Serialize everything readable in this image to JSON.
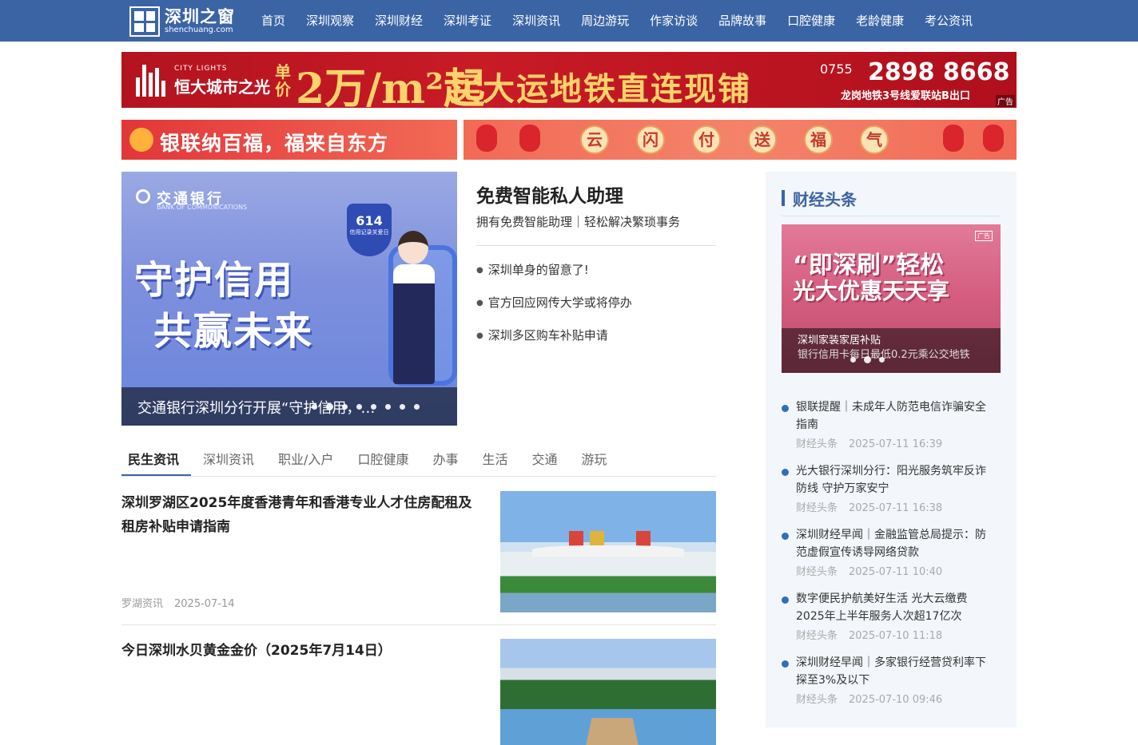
{
  "site": {
    "logo_cn": "深圳之窗",
    "logo_en": "shenchuang.com"
  },
  "nav": {
    "items": [
      "首页",
      "深圳观察",
      "深圳财经",
      "深圳考证",
      "深圳资讯",
      "周边游玩",
      "作家访谈",
      "品牌故事",
      "口腔健康",
      "老龄健康",
      "考公资讯"
    ]
  },
  "ads": {
    "top": {
      "brand_en": "CITY LIGHTS",
      "brand_cn": "恒大城市之光",
      "price_prefix": "单价",
      "price": "2万/m²起",
      "slogan": "买大运地铁直连现铺",
      "tel_area": "0755",
      "tel": "2898 8668",
      "address": "龙岗地铁3号线爱联站B出口",
      "tag": "广告"
    },
    "banner_left": "银联纳百福，福来自东方",
    "banner_right_chars": [
      "云",
      "闪",
      "付",
      "送",
      "福",
      "气"
    ]
  },
  "slider": {
    "bank": "交通银行",
    "bank_sub": "BANK OF COMMUNICATIONS",
    "badge_num": "614",
    "badge_text": "信用记录关爱日",
    "headline1": "守护信用",
    "headline2": "共赢未来",
    "caption": "交通银行深圳分行开展“守护信用，共赢未来”",
    "dot_count": 8,
    "active_dot": 1
  },
  "assistant": {
    "title": "免费智能私人助理",
    "desc": "拥有免费智能助理｜轻松解决繁琐事务",
    "links": [
      "深圳单身的留意了!",
      "官方回应网传大学或将停办",
      "深圳多区购车补贴申请"
    ]
  },
  "tabs": [
    "民生资讯",
    "深圳资讯",
    "职业/入户",
    "口腔健康",
    "办事",
    "生活",
    "交通",
    "游玩"
  ],
  "news": [
    {
      "title": "深圳罗湖区2025年度香港青年和香港专业人才住房配租及租房补贴申请指南",
      "source": "罗湖资讯",
      "date": "2025-07-14"
    },
    {
      "title": "今日深圳水贝黄金金价（2025年7月14日）"
    }
  ],
  "sidebar": {
    "heading": "财经头条",
    "slide": {
      "headline1": "“即深刷”轻松",
      "headline2": "光大优惠天天享",
      "caption": "深圳家装家居补贴",
      "caption2": "银行信用卡每日最低0.2元乘公交地铁",
      "tag": "广告"
    },
    "items": [
      {
        "title": "银联提醒｜未成年人防范电信诈骗安全指南",
        "source": "财经头条",
        "time": "2025-07-11 16:39"
      },
      {
        "title": "光大银行深圳分行：阳光服务筑牢反诈防线 守护万家安宁",
        "source": "财经头条",
        "time": "2025-07-11 16:38"
      },
      {
        "title": "深圳财经早闻｜金融监管总局提示：防范虚假宣传诱导网络贷款",
        "source": "财经头条",
        "time": "2025-07-11 10:40"
      },
      {
        "title": "数字便民护航美好生活 光大云缴费2025年上半年服务人次超17亿次",
        "source": "财经头条",
        "time": "2025-07-10 11:18"
      },
      {
        "title": "深圳财经早闻｜多家银行经营贷利率下探至3%及以下",
        "source": "财经头条",
        "time": "2025-07-10 09:46"
      }
    ]
  }
}
